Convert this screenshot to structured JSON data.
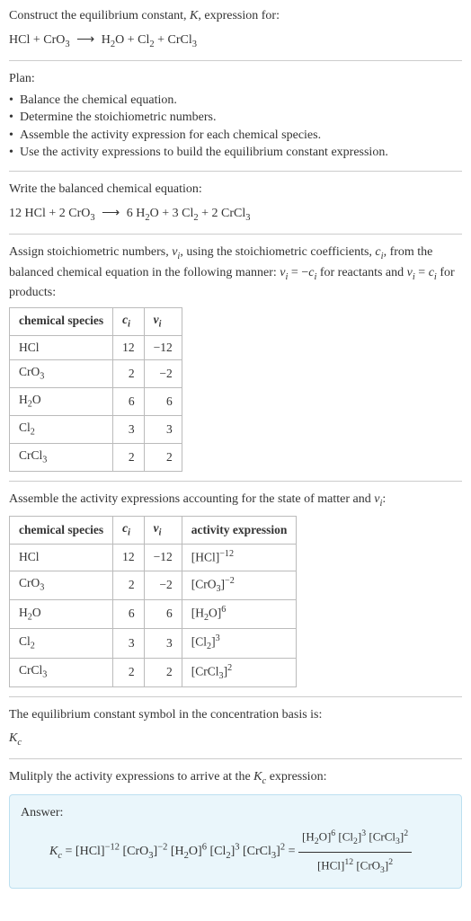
{
  "title": {
    "prompt_prefix": "Construct the equilibrium constant, ",
    "prompt_var": "K",
    "prompt_suffix": ", expression for:"
  },
  "unbalanced": {
    "left1": "HCl",
    "left2": "CrO",
    "left2_sub": "3",
    "right1": "H",
    "right1_sub": "2",
    "right1b": "O",
    "right2": "Cl",
    "right2_sub": "2",
    "right3": "CrCl",
    "right3_sub": "3"
  },
  "plan": {
    "label": "Plan:",
    "b1": "Balance the chemical equation.",
    "b2": "Determine the stoichiometric numbers.",
    "b3": "Assemble the activity expression for each chemical species.",
    "b4": "Use the activity expressions to build the equilibrium constant expression."
  },
  "balanced_label": "Write the balanced chemical equation:",
  "balanced": {
    "c1": "12",
    "s1": "HCl",
    "c2": "2",
    "s2": "CrO",
    "s2_sub": "3",
    "c3": "6",
    "s3a": "H",
    "s3a_sub": "2",
    "s3b": "O",
    "c4": "3",
    "s4": "Cl",
    "s4_sub": "2",
    "c5": "2",
    "s5": "CrCl",
    "s5_sub": "3"
  },
  "assign_label": {
    "p1": "Assign stoichiometric numbers, ",
    "nu": "ν",
    "sub_i": "i",
    "p2": ", using the stoichiometric coefficients, ",
    "c": "c",
    "p3": ", from the balanced chemical equation in the following manner: ",
    "eq1": "ν",
    "eq2": " = −",
    "eq3": " for reactants and ",
    "eq4": " = ",
    "eq5": " for products:"
  },
  "table1": {
    "h1": "chemical species",
    "h2a": "c",
    "h2b": "i",
    "h3a": "ν",
    "h3b": "i",
    "rows": [
      {
        "sp": "HCl",
        "sub": "",
        "c": "12",
        "nu": "−12"
      },
      {
        "sp": "CrO",
        "sub": "3",
        "c": "2",
        "nu": "−2"
      },
      {
        "sp": "H",
        "mid": "2",
        "sp2": "O",
        "c": "6",
        "nu": "6"
      },
      {
        "sp": "Cl",
        "sub": "2",
        "c": "3",
        "nu": "3"
      },
      {
        "sp": "CrCl",
        "sub": "3",
        "c": "2",
        "nu": "2"
      }
    ]
  },
  "table2_label": {
    "p1": "Assemble the activity expressions accounting for the state of matter and ",
    "nu": "ν",
    "sub_i": "i",
    "p2": ":"
  },
  "table2": {
    "h1": "chemical species",
    "h2a": "c",
    "h2b": "i",
    "h3a": "ν",
    "h3b": "i",
    "h4": "activity expression",
    "rows": [
      {
        "sp": "HCl",
        "sub": "",
        "c": "12",
        "nu": "−12",
        "base": "[HCl]",
        "exp": "−12"
      },
      {
        "sp": "CrO",
        "sub": "3",
        "c": "2",
        "nu": "−2",
        "base": "[CrO",
        "bsub": "3",
        "exp": "−2"
      },
      {
        "sp": "H",
        "mid": "2",
        "sp2": "O",
        "c": "6",
        "nu": "6",
        "base": "[H",
        "bsub": "2",
        "btail": "O]",
        "exp": "6"
      },
      {
        "sp": "Cl",
        "sub": "2",
        "c": "3",
        "nu": "3",
        "base": "[Cl",
        "bsub": "2",
        "exp": "3"
      },
      {
        "sp": "CrCl",
        "sub": "3",
        "c": "2",
        "nu": "2",
        "base": "[CrCl",
        "bsub": "3",
        "exp": "2"
      }
    ]
  },
  "kc_label": "The equilibrium constant symbol in the concentration basis is:",
  "kc_sym": {
    "K": "K",
    "c": "c"
  },
  "final_label": {
    "p1": "Mulitply the activity expressions to arrive at the ",
    "p2": " expression:"
  },
  "answer": {
    "label": "Answer:",
    "lhs_K": "K",
    "lhs_c": "c",
    "eq": " = ",
    "t1": "[HCl]",
    "e1": "−12",
    "t2a": "[CrO",
    "t2b": "3",
    "e2": "−2",
    "t3a": "[H",
    "t3b": "2",
    "t3c": "O]",
    "e3": "6",
    "t4a": "[Cl",
    "t4b": "2",
    "e4": "3",
    "t5a": "[CrCl",
    "t5b": "3",
    "e5": "2",
    "eq2": " = ",
    "num1a": "[H",
    "num1b": "2",
    "num1c": "O]",
    "ne1": "6",
    "num2a": "[Cl",
    "num2b": "2",
    "ne2": "3",
    "num3a": "[CrCl",
    "num3b": "3",
    "ne3": "2",
    "den1": "[HCl]",
    "de1": "12",
    "den2a": "[CrO",
    "den2b": "3",
    "de2": "2"
  },
  "chart_data": {
    "type": "table",
    "tables": [
      {
        "columns": [
          "chemical species",
          "c_i",
          "nu_i"
        ],
        "rows": [
          [
            "HCl",
            12,
            -12
          ],
          [
            "CrO3",
            2,
            -2
          ],
          [
            "H2O",
            6,
            6
          ],
          [
            "Cl2",
            3,
            3
          ],
          [
            "CrCl3",
            2,
            2
          ]
        ]
      },
      {
        "columns": [
          "chemical species",
          "c_i",
          "nu_i",
          "activity expression"
        ],
        "rows": [
          [
            "HCl",
            12,
            -12,
            "[HCl]^-12"
          ],
          [
            "CrO3",
            2,
            -2,
            "[CrO3]^-2"
          ],
          [
            "H2O",
            6,
            6,
            "[H2O]^6"
          ],
          [
            "Cl2",
            3,
            3,
            "[Cl2]^3"
          ],
          [
            "CrCl3",
            2,
            2,
            "[CrCl3]^2"
          ]
        ]
      }
    ]
  }
}
